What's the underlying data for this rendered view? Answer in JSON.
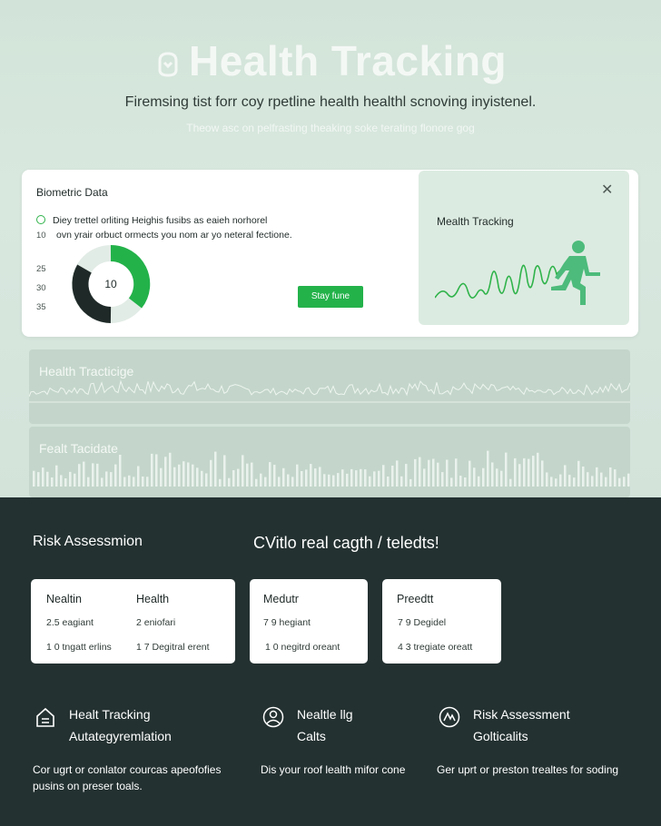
{
  "hero": {
    "title": "Health Tracking",
    "subtitle": "Firemsing tist forr coy rpetline health healthl scnoving inyistenel.",
    "tagline": "Theow asc on pelfrasting theaking soke terating flonore gog"
  },
  "biometric_card": {
    "title": "Biometric Data",
    "line1": "Diey trettel orliting Heighis fusibs as eaieh norhorel",
    "line2": "ovn yrair orbuct ormects you nom ar yo neteral fectione.",
    "y_ticks": [
      "10",
      "25",
      "30",
      "35"
    ],
    "donut_value": "10",
    "donut_fraction": 0.42,
    "button_label": "Stay fune"
  },
  "tracking_panel": {
    "title": "Mealth Tracking",
    "close_icon": "close-icon"
  },
  "strips": [
    {
      "label": "Health Tracticige"
    },
    {
      "label": "Fealt Tacidate"
    }
  ],
  "risk": {
    "title": "Risk Assessmion",
    "tagline": "CVitlo real cagth / teledts!",
    "cards": [
      {
        "columns": [
          {
            "heading": "Nealtin",
            "row1": "2.5 eagiant",
            "row2": "1 0 tngatt erlins"
          },
          {
            "heading": "Health",
            "row1": "2 eniofari",
            "row2": "1 7 Degitral erent"
          }
        ]
      },
      {
        "columns": [
          {
            "heading": "Medutr",
            "row1": "7 9 hegiant",
            "row2": "1 0 negitrd oreant"
          }
        ]
      },
      {
        "columns": [
          {
            "heading": "Preedtt",
            "row1": "7 9 Degidel",
            "row2": "4 3 tregiate oreatt"
          }
        ]
      }
    ]
  },
  "features": [
    {
      "icon": "house-icon",
      "line1": "Healt Tracking",
      "line2": "Autategyremlation",
      "desc": [
        "Cor ugrt or conlator courcas apeofofies",
        "pusins on preser toals."
      ]
    },
    {
      "icon": "user-icon",
      "line1": "Nealtle llg",
      "line2": "Calts",
      "desc": [
        "Dis your roof lealth mifor cone"
      ]
    },
    {
      "icon": "shield-icon",
      "line1": "Risk Assessment",
      "line2": "Golticalits",
      "desc": [
        "Ger uprt or preston trealtes for soding"
      ]
    }
  ],
  "colors": {
    "accent_green": "#23b24a",
    "dark_bg": "#243131",
    "light_bg": "#d6e6dc"
  }
}
